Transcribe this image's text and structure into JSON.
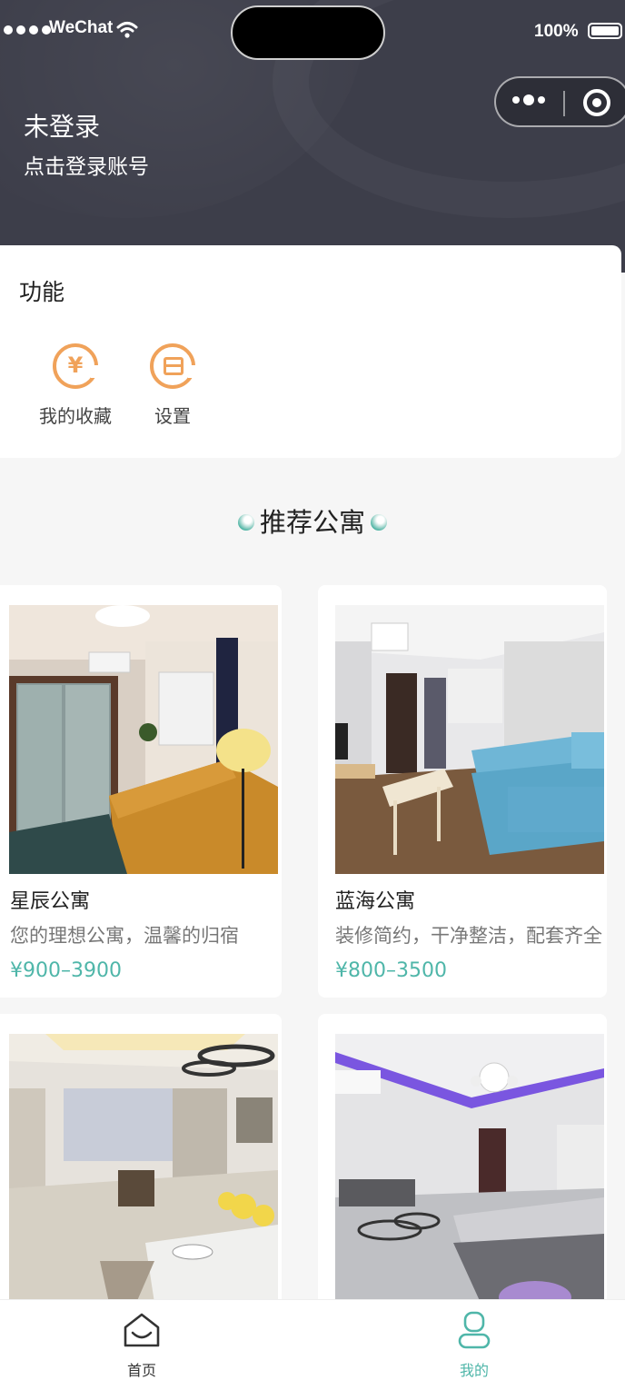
{
  "status_bar": {
    "carrier": "WeChat",
    "battery": "100%"
  },
  "profile": {
    "title": "未登录",
    "subtitle": "点击登录账号"
  },
  "functions": {
    "title": "功能",
    "items": [
      {
        "label": "我的收藏",
        "icon": "yen-refresh-icon"
      },
      {
        "label": "设置",
        "icon": "settings-box-icon"
      }
    ]
  },
  "recommend": {
    "title": "推荐公寓",
    "apartments": [
      {
        "name": "星辰公寓",
        "desc": "您的理想公寓，温馨的归宿",
        "price": "¥900–3900"
      },
      {
        "name": "蓝海公寓",
        "desc": "装修简约，干净整洁，配套齐全",
        "price": "¥800–3500"
      },
      {
        "name": "",
        "desc": "",
        "price": ""
      },
      {
        "name": "",
        "desc": "",
        "price": ""
      }
    ]
  },
  "tabbar": {
    "items": [
      {
        "label": "首页",
        "icon": "home-icon"
      },
      {
        "label": "我的",
        "icon": "user-icon"
      }
    ],
    "active_color": "#4fb6a9"
  },
  "colors": {
    "header_bg": "#3d3e4a",
    "accent": "#4fb6a9",
    "icon_orange": "#f0a25a"
  }
}
